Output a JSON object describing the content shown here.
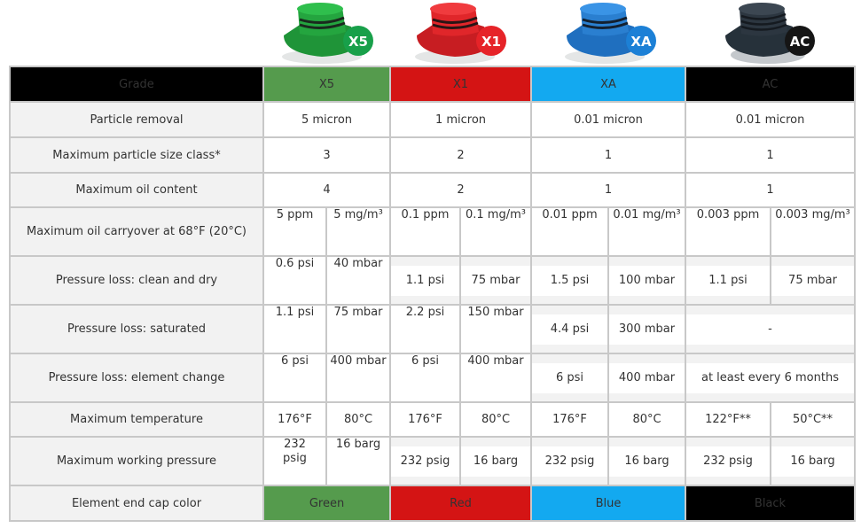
{
  "products": [
    {
      "code": "X5",
      "color_name": "Green",
      "header_bg": "#559b4d",
      "cap_color": "#22a03c",
      "badge_bg": "#18a04a",
      "cap_bg": "#559b4d"
    },
    {
      "code": "X1",
      "color_name": "Red",
      "header_bg": "#d41414",
      "cap_color": "#e0262a",
      "badge_bg": "#e62328",
      "cap_bg": "#d41414"
    },
    {
      "code": "XA",
      "color_name": "Blue",
      "header_bg": "#13a9f0",
      "cap_color": "#2a7fd0",
      "badge_bg": "#1c80d6",
      "cap_bg": "#13a9f0"
    },
    {
      "code": "AC",
      "color_name": "Black",
      "header_bg": "#000000",
      "cap_color": "#2c3640",
      "badge_bg": "#151515",
      "cap_bg": "#000000"
    }
  ],
  "table": {
    "grade_label": "Grade",
    "rows": {
      "particle_removal": {
        "label": "Particle removal",
        "values": [
          "5 micron",
          "1 micron",
          "0.01 micron",
          "0.01 micron"
        ]
      },
      "particle_size_class": {
        "label": "Maximum particle size class*",
        "values": [
          "3",
          "2",
          "1",
          "1"
        ]
      },
      "oil_content": {
        "label": "Maximum oil content",
        "values": [
          "4",
          "2",
          "1",
          "1"
        ]
      },
      "oil_carryover": {
        "label": "Maximum oil carryover at 68°F (20°C)",
        "values": [
          [
            "5 ppm",
            "5 mg/m³"
          ],
          [
            "0.1 ppm",
            "0.1 mg/m³"
          ],
          [
            "0.01 ppm",
            "0.01 mg/m³"
          ],
          [
            "0.003 ppm",
            "0.003 mg/m³"
          ]
        ]
      },
      "pl_clean": {
        "label": "Pressure loss: clean and dry",
        "values": [
          [
            "0.6 psi",
            "40 mbar"
          ],
          [
            "1.1 psi",
            "75 mbar"
          ],
          [
            "1.5 psi",
            "100 mbar"
          ],
          [
            "1.1 psi",
            "75 mbar"
          ]
        ]
      },
      "pl_saturated": {
        "label": "Pressure loss: saturated",
        "values": [
          [
            "1.1 psi",
            "75 mbar"
          ],
          [
            "2.2 psi",
            "150 mbar"
          ],
          [
            "4.4 psi",
            "300 mbar"
          ],
          "-"
        ]
      },
      "pl_element_change": {
        "label": "Pressure loss: element change",
        "values": [
          [
            "6 psi",
            "400 mbar"
          ],
          [
            "6 psi",
            "400 mbar"
          ],
          [
            "6 psi",
            "400 mbar"
          ],
          "at least every 6 months"
        ]
      },
      "max_temp": {
        "label": "Maximum temperature",
        "values": [
          [
            "176°F",
            "80°C"
          ],
          [
            "176°F",
            "80°C"
          ],
          [
            "176°F",
            "80°C"
          ],
          [
            "122°F**",
            "50°C**"
          ]
        ]
      },
      "max_pressure": {
        "label": "Maximum working pressure",
        "values": [
          [
            "232 psig",
            "16 barg"
          ],
          [
            "232 psig",
            "16 barg"
          ],
          [
            "232 psig",
            "16 barg"
          ],
          [
            "232 psig",
            "16 barg"
          ]
        ]
      },
      "cap_color": {
        "label": "Element end cap color",
        "values": [
          "Green",
          "Red",
          "Blue",
          "Black"
        ]
      }
    }
  }
}
